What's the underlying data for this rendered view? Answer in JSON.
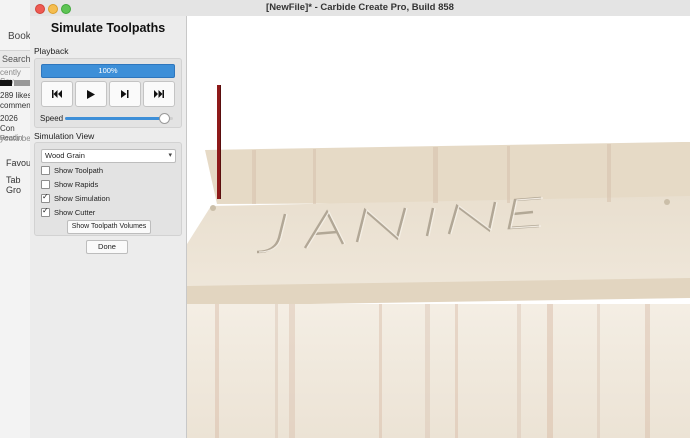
{
  "window": {
    "title": "[NewFile]* - Carbide Create Pro, Build 858"
  },
  "background": {
    "bookmarks": "Book",
    "search": "Search",
    "recently_saved": "cently Sav",
    "likes": "289 likes,",
    "comments": "comments",
    "year": "2026 Con",
    "site": "youtu.be",
    "reading": "Readin",
    "favourites": "Favouri",
    "tab_groups": "Tab Gro"
  },
  "panel": {
    "title": "Simulate Toolpaths",
    "playback_label": "Playback",
    "progress_text": "100%",
    "progress": 1.0,
    "buttons": [
      {
        "name": "rewind",
        "icon": "skip-back-icon"
      },
      {
        "name": "play",
        "icon": "play-icon"
      },
      {
        "name": "step",
        "icon": "step-forward-icon"
      },
      {
        "name": "fast-forward",
        "icon": "fast-forward-icon"
      }
    ],
    "speed_label": "Speed",
    "speed": 0.92,
    "sim_view_label": "Simulation View",
    "view_select": {
      "value": "Wood Grain"
    },
    "checkboxes": [
      {
        "label": "Show Toolpath",
        "checked": false
      },
      {
        "label": "Show Rapids",
        "checked": false
      },
      {
        "label": "Show Simulation",
        "checked": true
      },
      {
        "label": "Show Cutter",
        "checked": true
      }
    ],
    "volumes_button": "Show Toolpath Volumes",
    "done_button": "Done"
  },
  "viewport": {
    "carved_text": "JANINE",
    "colors": {
      "wood": "#efe6d8",
      "wood_dark": "#d9ccb7",
      "cutter": "#8e1a1a"
    }
  }
}
